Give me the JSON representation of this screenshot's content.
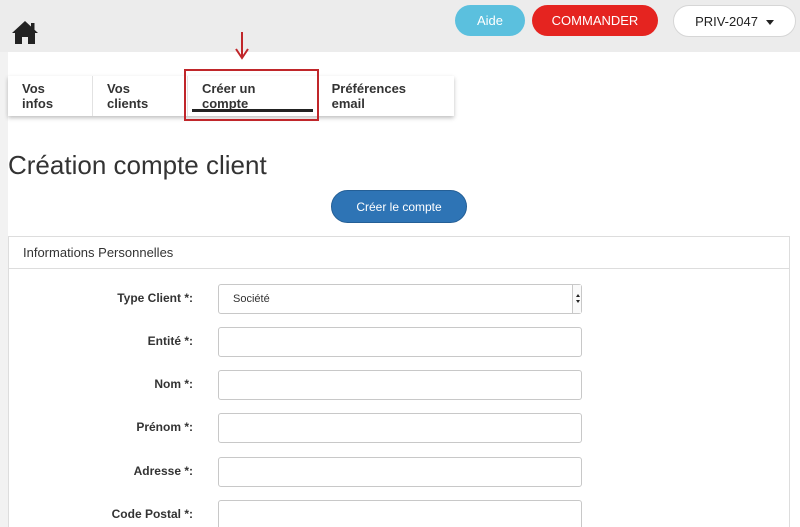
{
  "header": {
    "aide_label": "Aide",
    "commander_label": "COMMANDER",
    "account_label": "PRIV-2047"
  },
  "tabs": [
    {
      "label": "Vos infos"
    },
    {
      "label": "Vos clients"
    },
    {
      "label": "Créer un compte",
      "active": true
    },
    {
      "label": "Préférences email"
    }
  ],
  "page": {
    "title": "Création compte client",
    "create_button": "Créer le compte"
  },
  "panel": {
    "title": "Informations Personnelles",
    "fields": [
      {
        "label": "Type Client *:",
        "value": "Société",
        "type": "select"
      },
      {
        "label": "Entité *:",
        "value": ""
      },
      {
        "label": "Nom *:",
        "value": ""
      },
      {
        "label": "Prénom *:",
        "value": ""
      },
      {
        "label": "Adresse *:",
        "value": ""
      },
      {
        "label": "Code Postal *:",
        "value": ""
      }
    ]
  },
  "colors": {
    "aide": "#5bc0de",
    "commander": "#e52420",
    "primary": "#2e74b5",
    "annotation": "#c0262a"
  },
  "icons": [
    "home-icon",
    "chevron-down-icon",
    "arrow-down-icon"
  ]
}
